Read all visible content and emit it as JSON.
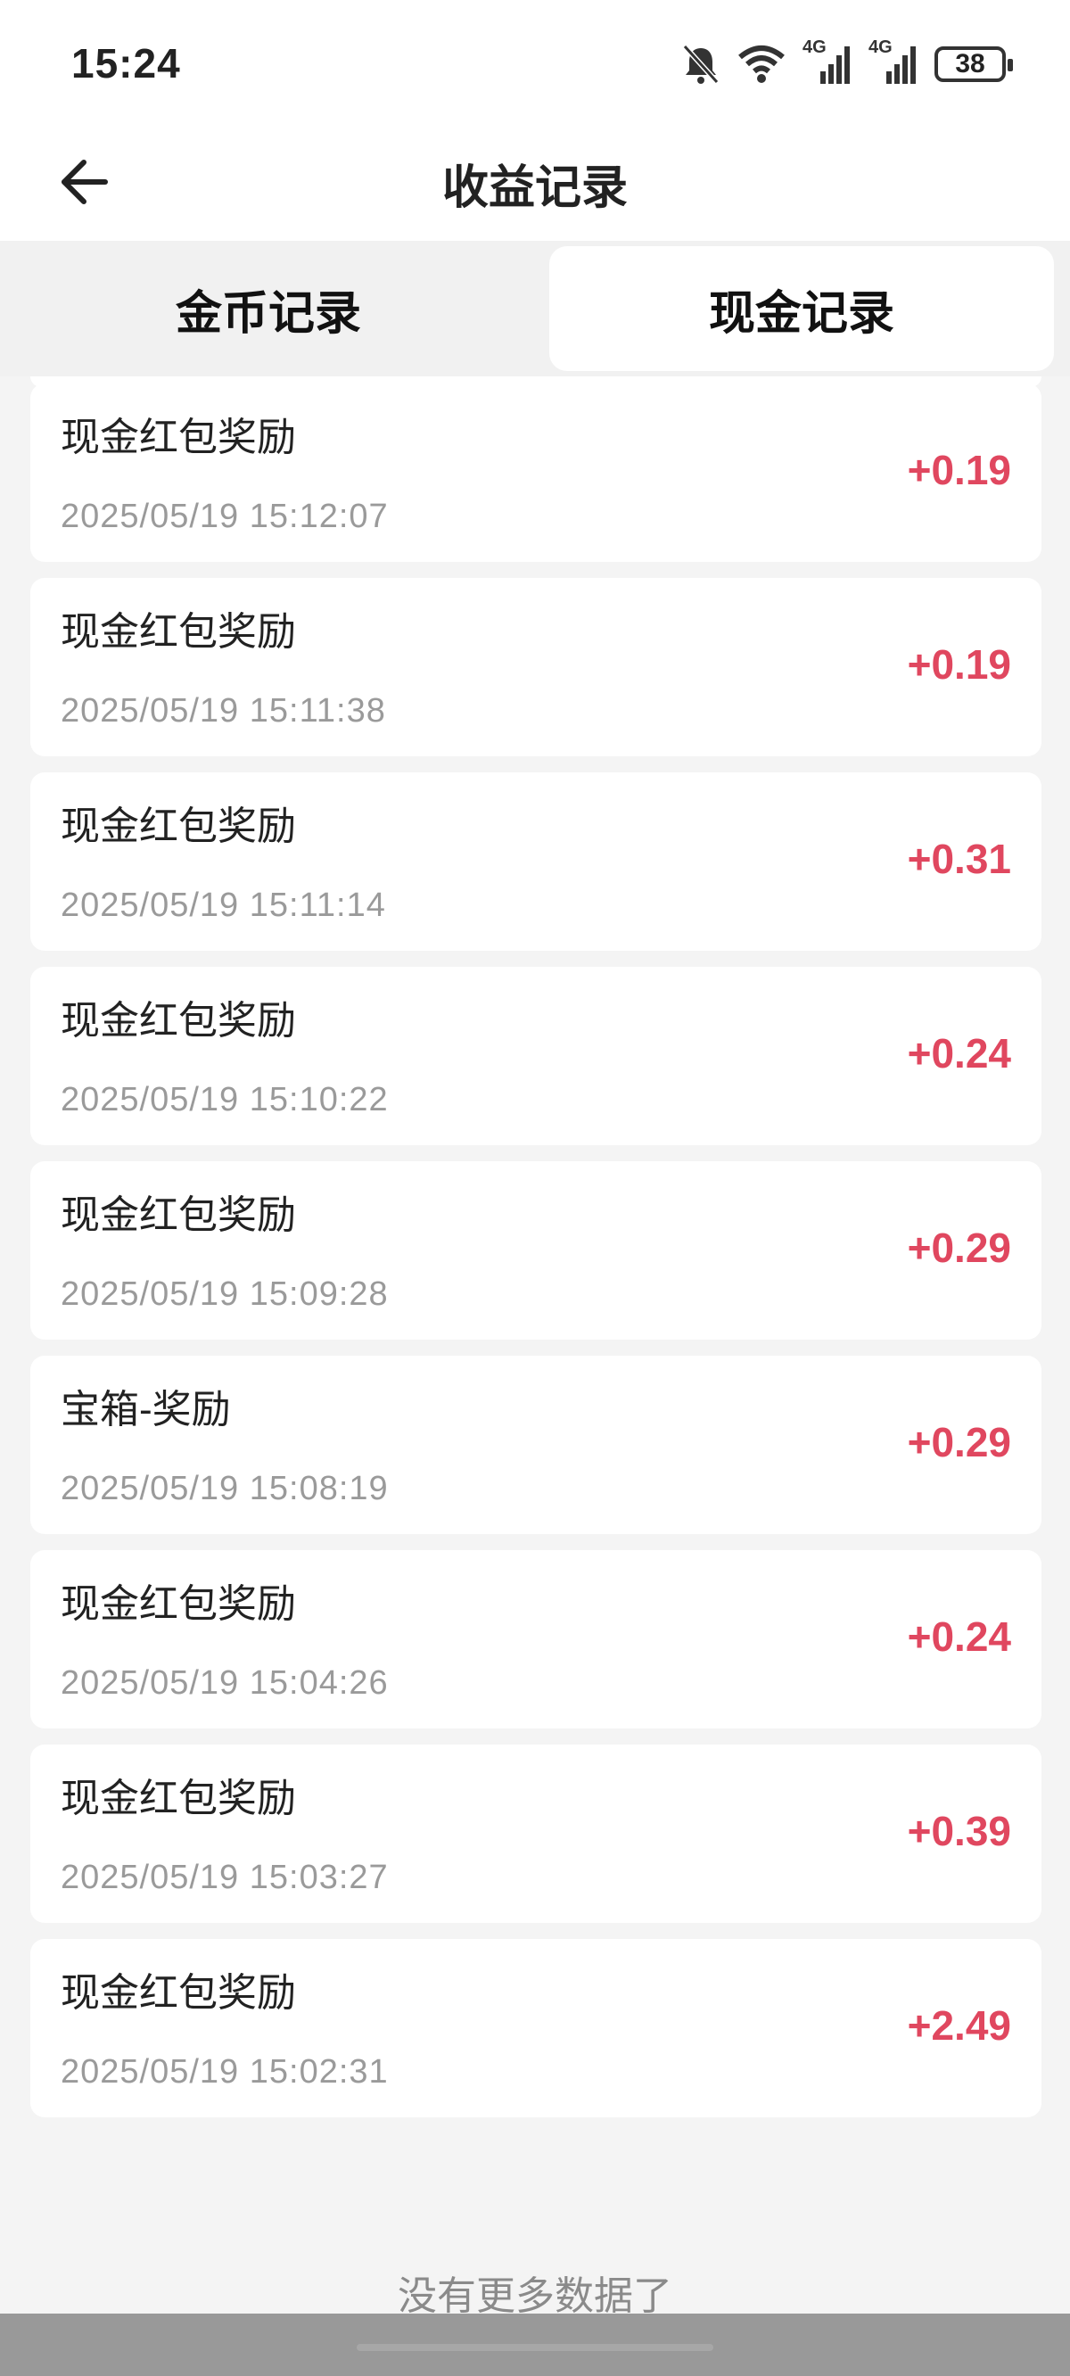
{
  "status_bar": {
    "time": "15:24",
    "icons": [
      "bell-muted-icon",
      "wifi-icon",
      "signal-4g-icon",
      "signal-4g-icon"
    ],
    "network_labels": [
      "4G",
      "4G"
    ],
    "battery": "38"
  },
  "header": {
    "title": "收益记录",
    "back_icon": "arrow-left-icon"
  },
  "tabs": [
    {
      "label": "金币记录",
      "active": false
    },
    {
      "label": "现金记录",
      "active": true
    }
  ],
  "records": [
    {
      "title": "现金红包奖励",
      "time": "2025/05/19 15:12:07",
      "amount": "+0.19"
    },
    {
      "title": "现金红包奖励",
      "time": "2025/05/19 15:11:38",
      "amount": "+0.19"
    },
    {
      "title": "现金红包奖励",
      "time": "2025/05/19 15:11:14",
      "amount": "+0.31"
    },
    {
      "title": "现金红包奖励",
      "time": "2025/05/19 15:10:22",
      "amount": "+0.24"
    },
    {
      "title": "现金红包奖励",
      "time": "2025/05/19 15:09:28",
      "amount": "+0.29"
    },
    {
      "title": "宝箱-奖励",
      "time": "2025/05/19 15:08:19",
      "amount": "+0.29"
    },
    {
      "title": "现金红包奖励",
      "time": "2025/05/19 15:04:26",
      "amount": "+0.24"
    },
    {
      "title": "现金红包奖励",
      "time": "2025/05/19 15:03:27",
      "amount": "+0.39"
    },
    {
      "title": "现金红包奖励",
      "time": "2025/05/19 15:02:31",
      "amount": "+2.49"
    }
  ],
  "footer": {
    "no_more": "没有更多数据了"
  },
  "colors": {
    "amount": "#e0475f",
    "background": "#f4f4f4",
    "card": "#ffffff"
  }
}
